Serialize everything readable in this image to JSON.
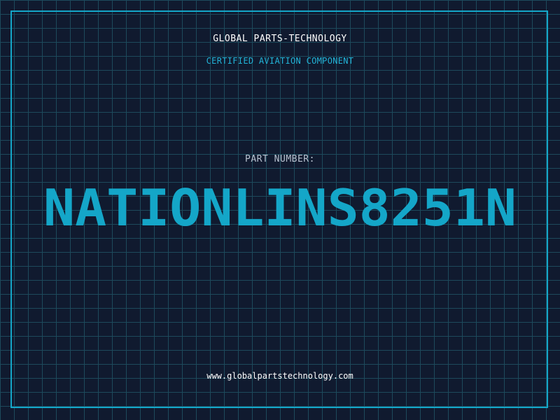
{
  "header": {
    "company_name": "GLOBAL PARTS-TECHNOLOGY",
    "subtitle": "CERTIFIED AVIATION COMPONENT"
  },
  "part": {
    "label": "PART NUMBER:",
    "number": "NATIONLINS8251N"
  },
  "footer": {
    "website": "www.globalpartstechnology.com"
  },
  "colors": {
    "background": "#101a2f",
    "grid": "#1d4a5c",
    "accent": "#14a6c8",
    "text": "#ffffff"
  }
}
